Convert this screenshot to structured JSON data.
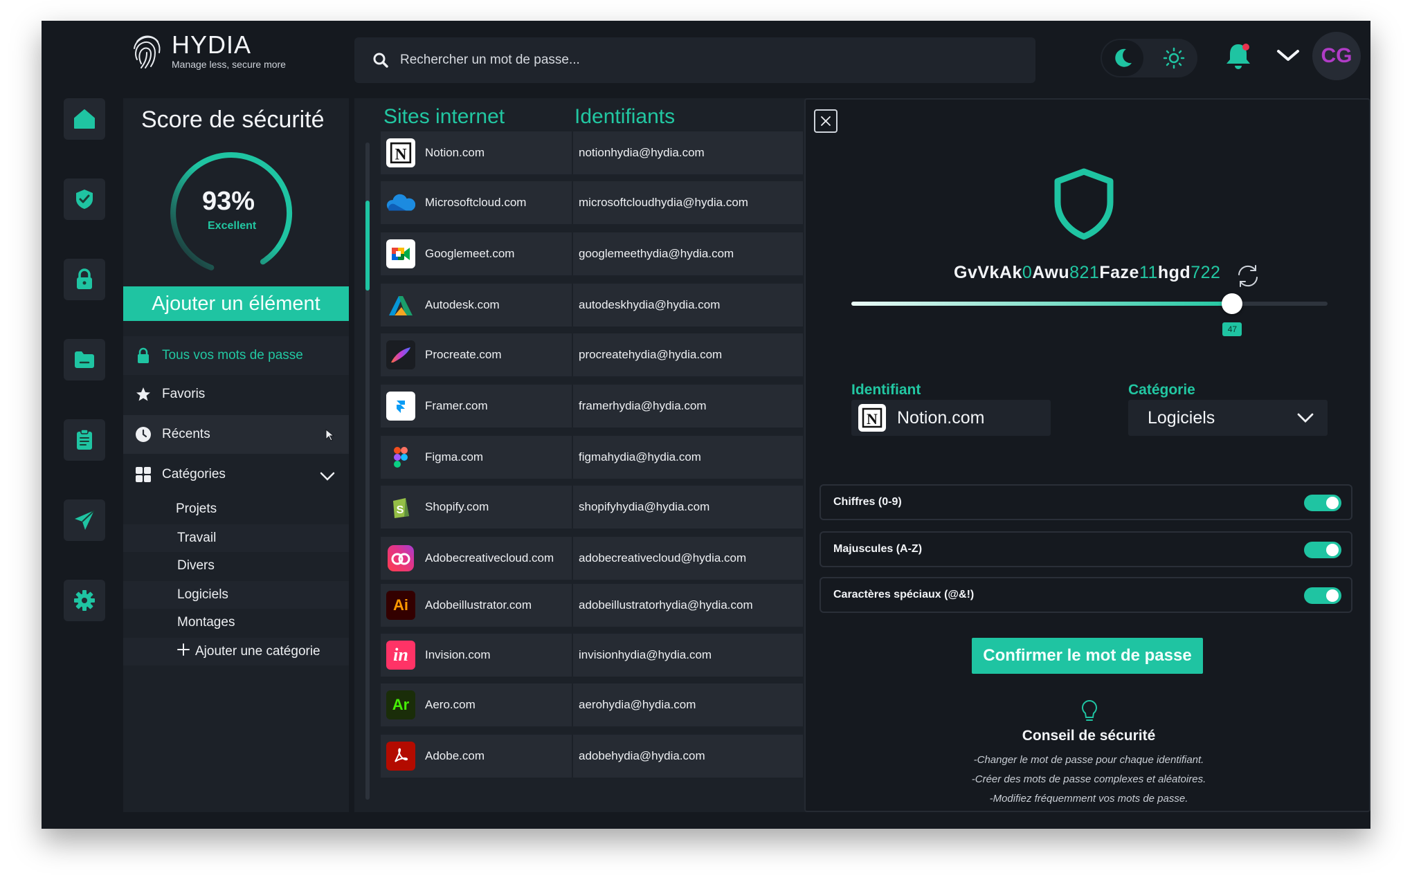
{
  "app": {
    "name": "HYDIA",
    "tagline": "Manage less, secure more",
    "brand_color": "#1fc4a2",
    "avatar_initials": "CG"
  },
  "search": {
    "placeholder": "Rechercher un mot de passe..."
  },
  "rail": [
    "home-icon",
    "shield-check-icon",
    "lock-icon",
    "folder-icon",
    "clipboard-icon",
    "send-icon",
    "gear-icon"
  ],
  "score": {
    "title": "Score de sécurité",
    "value": "93%",
    "percent": 93,
    "label": "Excellent"
  },
  "add_button": "Ajouter un élément",
  "nav": {
    "all": "Tous vos mots de passe",
    "favorites": "Favoris",
    "recents": "Récents",
    "categories": "Catégories",
    "subcategories": [
      "Projets",
      "Travail",
      "Divers",
      "Logiciels",
      "Montages"
    ],
    "add_category": "Ajouter une catégorie"
  },
  "list": {
    "col_sites": "Sites internet",
    "col_idents": "Identifiants",
    "rows": [
      {
        "site": "Notion.com",
        "ident": "notionhydia@hydia.com",
        "logo": "N"
      },
      {
        "site": "Microsoftcloud.com",
        "ident": "microsoftcloudhydia@hydia.com",
        "logo": ""
      },
      {
        "site": "Googlemeet.com",
        "ident": "googlemeethydia@hydia.com",
        "logo": ""
      },
      {
        "site": "Autodesk.com",
        "ident": "autodeskhydia@hydia.com",
        "logo": ""
      },
      {
        "site": "Procreate.com",
        "ident": "procreatehydia@hydia.com",
        "logo": ""
      },
      {
        "site": "Framer.com",
        "ident": "framerhydia@hydia.com",
        "logo": ""
      },
      {
        "site": "Figma.com",
        "ident": "figmahydia@hydia.com",
        "logo": ""
      },
      {
        "site": "Shopify.com",
        "ident": "shopifyhydia@hydia.com",
        "logo": ""
      },
      {
        "site": "Adobecreativecloud.com",
        "ident": "adobecreativecloud@hydia.com",
        "logo": ""
      },
      {
        "site": "Adobeillustrator.com",
        "ident": "adobeillustratorhydia@hydia.com",
        "logo": "Ai"
      },
      {
        "site": "Invision.com",
        "ident": "invisionhydia@hydia.com",
        "logo": "in"
      },
      {
        "site": "Aero.com",
        "ident": "aerohydia@hydia.com",
        "logo": "Ar"
      },
      {
        "site": "Adobe.com",
        "ident": "adobehydia@hydia.com",
        "logo": ""
      }
    ]
  },
  "detail": {
    "password_parts": [
      {
        "t": "GvVkAk",
        "g": false
      },
      {
        "t": "0",
        "g": true
      },
      {
        "t": "Awu",
        "g": false
      },
      {
        "t": "821",
        "g": true
      },
      {
        "t": "Faze",
        "g": false
      },
      {
        "t": "11",
        "g": true
      },
      {
        "t": "hgd",
        "g": false
      },
      {
        "t": "722",
        "g": true
      }
    ],
    "length": 47,
    "length_fraction": 0.8,
    "identifiant_label": "Identifiant",
    "identifiant_value": "Notion.com",
    "categorie_label": "Catégorie",
    "categorie_value": "Logiciels",
    "toggles": [
      {
        "label": "Chiffres (0-9)",
        "on": true
      },
      {
        "label": "Majuscules (A-Z)",
        "on": true
      },
      {
        "label": "Caractères spéciaux (@&!)",
        "on": true
      }
    ],
    "confirm_label": "Confirmer le mot de passe",
    "tip_title": "Conseil de sécurité",
    "tips": [
      "-Changer le mot de passe pour chaque identifiant.",
      "-Créer des mots de passe complexes et aléatoires.",
      "-Modifiez fréquemment vos mots de passe."
    ]
  }
}
